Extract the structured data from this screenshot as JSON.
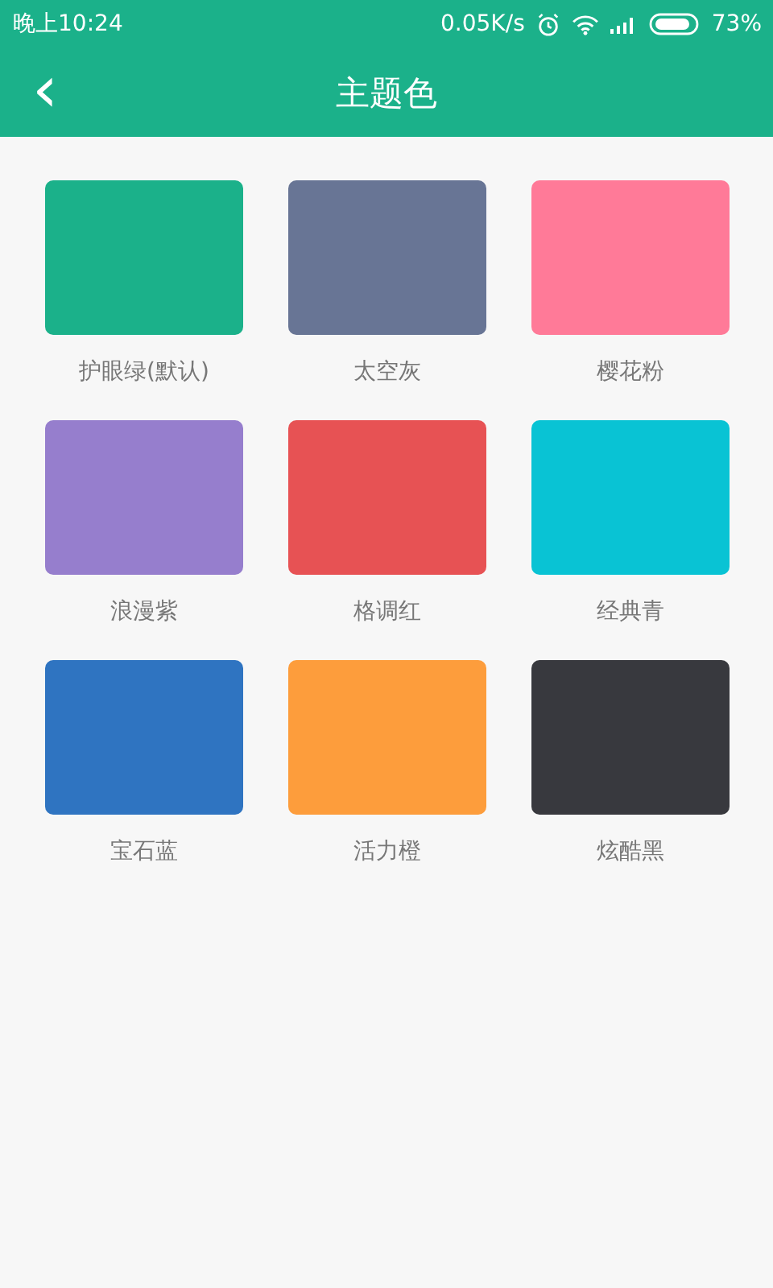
{
  "status_bar": {
    "time": "晚上10:24",
    "speed": "0.05K/s",
    "battery": "73%"
  },
  "header": {
    "back": "‹",
    "title": "主题色"
  },
  "themes": [
    {
      "label": "护眼绿(默认)",
      "color": "#1bb18a"
    },
    {
      "label": "太空灰",
      "color": "#687595"
    },
    {
      "label": "樱花粉",
      "color": "#ff7a98"
    },
    {
      "label": "浪漫紫",
      "color": "#967ecd"
    },
    {
      "label": "格调红",
      "color": "#e75254"
    },
    {
      "label": "经典青",
      "color": "#09c3d4"
    },
    {
      "label": "宝石蓝",
      "color": "#2f74c1"
    },
    {
      "label": "活力橙",
      "color": "#fd9d3c"
    },
    {
      "label": "炫酷黑",
      "color": "#38393e"
    }
  ]
}
